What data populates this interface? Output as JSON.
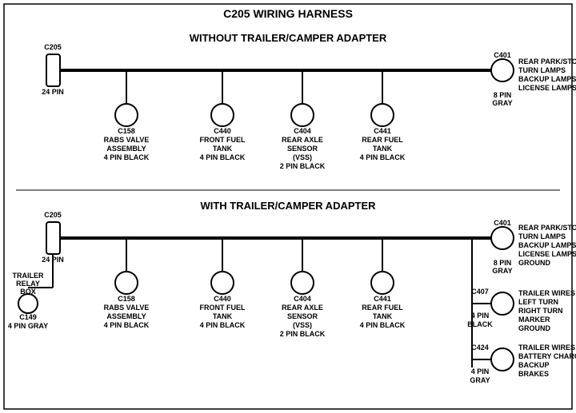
{
  "title": "C205 WIRING HARNESS",
  "section1": {
    "label": "WITHOUT TRAILER/CAMPER ADAPTER",
    "left_connector": {
      "name": "C205",
      "pins": "24 PIN"
    },
    "right_connector": {
      "name": "C401",
      "pins": "8 PIN",
      "color": "GRAY"
    },
    "right_labels": [
      "REAR PARK/STOP",
      "TURN LAMPS",
      "BACKUP LAMPS",
      "LICENSE LAMPS"
    ],
    "connectors": [
      {
        "name": "C158",
        "line1": "RABS VALVE",
        "line2": "ASSEMBLY",
        "line3": "4 PIN BLACK"
      },
      {
        "name": "C440",
        "line1": "FRONT FUEL",
        "line2": "TANK",
        "line3": "4 PIN BLACK"
      },
      {
        "name": "C404",
        "line1": "REAR AXLE",
        "line2": "SENSOR",
        "line3": "(VSS)",
        "line4": "2 PIN BLACK"
      },
      {
        "name": "C441",
        "line1": "REAR FUEL",
        "line2": "TANK",
        "line3": "4 PIN BLACK"
      }
    ]
  },
  "section2": {
    "label": "WITH TRAILER/CAMPER ADAPTER",
    "left_connector": {
      "name": "C205",
      "pins": "24 PIN"
    },
    "right_connector": {
      "name": "C401",
      "pins": "8 PIN",
      "color": "GRAY"
    },
    "right_labels1": [
      "REAR PARK/STOP",
      "TURN LAMPS",
      "BACKUP LAMPS",
      "LICENSE LAMPS",
      "GROUND"
    ],
    "extra_left": {
      "relay": "TRAILER",
      "relay2": "RELAY",
      "relay3": "BOX",
      "name": "C149",
      "pins": "4 PIN GRAY"
    },
    "connectors": [
      {
        "name": "C158",
        "line1": "RABS VALVE",
        "line2": "ASSEMBLY",
        "line3": "4 PIN BLACK"
      },
      {
        "name": "C440",
        "line1": "FRONT FUEL",
        "line2": "TANK",
        "line3": "4 PIN BLACK"
      },
      {
        "name": "C404",
        "line1": "REAR AXLE",
        "line2": "SENSOR",
        "line3": "(VSS)",
        "line4": "2 PIN BLACK"
      },
      {
        "name": "C441",
        "line1": "REAR FUEL",
        "line2": "TANK",
        "line3": "4 PIN BLACK"
      }
    ],
    "right_connector2": {
      "name": "C407",
      "pins": "4 PIN",
      "color": "BLACK"
    },
    "right_labels2": [
      "TRAILER WIRES",
      "LEFT TURN",
      "RIGHT TURN",
      "MARKER",
      "GROUND"
    ],
    "right_connector3": {
      "name": "C424",
      "pins": "4 PIN",
      "color": "GRAY"
    },
    "right_labels3": [
      "TRAILER WIRES",
      "BATTERY CHARGE",
      "BACKUP",
      "BRAKES"
    ]
  }
}
